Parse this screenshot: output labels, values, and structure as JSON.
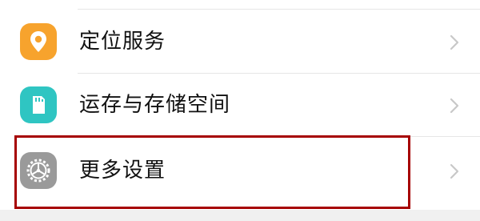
{
  "settings_list": {
    "items": [
      {
        "label": "定位服务",
        "icon": "location-pin-icon",
        "icon_color": "#f7a32d"
      },
      {
        "label": "运存与存储空间",
        "icon": "sd-card-icon",
        "icon_color": "#2fc5c2"
      },
      {
        "label": "更多设置",
        "icon": "gear-icon",
        "icon_color": "#9a9a9a"
      }
    ]
  },
  "annotation": {
    "highlight_color": "#a60000"
  }
}
